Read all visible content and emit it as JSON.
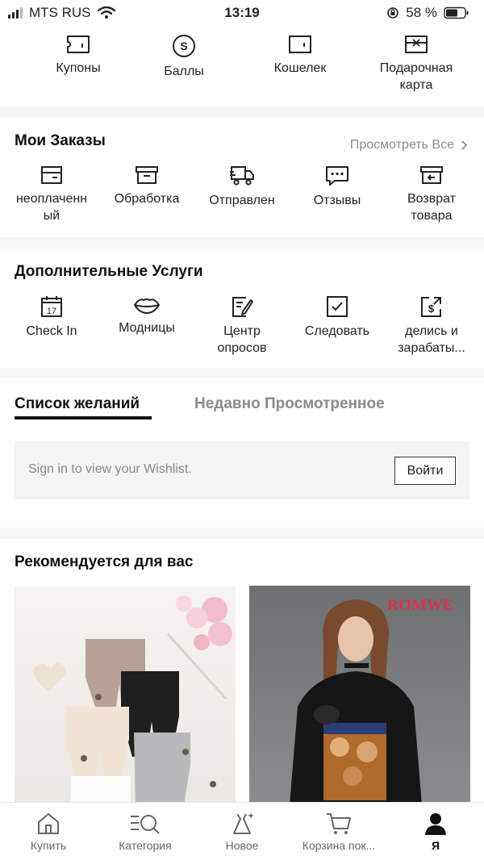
{
  "status": {
    "carrier": "MTS RUS",
    "time": "13:19",
    "battery": "58 %"
  },
  "quick": [
    {
      "label": "Купоны",
      "icon": "coupon-icon"
    },
    {
      "label": "Баллы",
      "icon": "points-icon"
    },
    {
      "label": "Кошелек",
      "icon": "wallet-icon"
    },
    {
      "label": "Подарочная\nкарта",
      "icon": "gift-card-icon"
    }
  ],
  "orders": {
    "title": "Мои Заказы",
    "view_all": "Просмотреть Все",
    "items": [
      {
        "label": "неоплаченн\nый",
        "icon": "unpaid-icon"
      },
      {
        "label": "Обработка",
        "icon": "processing-icon"
      },
      {
        "label": "Отправлен",
        "icon": "shipped-icon"
      },
      {
        "label": "Отзывы",
        "icon": "reviews-icon"
      },
      {
        "label": "Возврат\nтовара",
        "icon": "return-icon"
      }
    ]
  },
  "extras": {
    "title": "Дополнительные Услуги",
    "items": [
      {
        "label": "Check In",
        "icon": "calendar-icon"
      },
      {
        "label": "Модницы",
        "icon": "lips-icon"
      },
      {
        "label": "Центр\nопросов",
        "icon": "survey-icon"
      },
      {
        "label": "Следовать",
        "icon": "follow-icon"
      },
      {
        "label": "делись и\nзарабаты...",
        "icon": "share-earn-icon"
      }
    ]
  },
  "wishlist": {
    "tab_active": "Список желаний",
    "tab_inactive": "Недавно Просмотренное",
    "message": "Sign in to view your Wishlist.",
    "login": "Войти"
  },
  "recs": {
    "title": "Рекомендуется для вас",
    "products": [
      {
        "brand": ""
      },
      {
        "brand": "ROMWE"
      }
    ]
  },
  "tabbar": [
    {
      "label": "Купить",
      "icon": "home-icon"
    },
    {
      "label": "Категория",
      "icon": "category-icon"
    },
    {
      "label": "Новое",
      "icon": "new-icon"
    },
    {
      "label": "Корзина пок...",
      "icon": "cart-icon"
    },
    {
      "label": "Я",
      "icon": "profile-icon"
    }
  ],
  "colors": {
    "accent": "#111111",
    "muted": "#8a8a8a",
    "panel": "#f4f4f4",
    "page_bg": "#f6f6f6"
  }
}
